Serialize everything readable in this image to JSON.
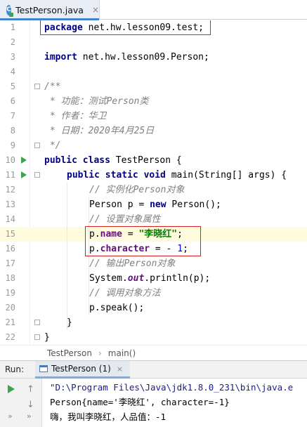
{
  "tab": {
    "icon_letter": "C",
    "filename": "TestPerson.java",
    "close": "×"
  },
  "editor": {
    "lines": [
      {
        "n": "1"
      },
      {
        "n": "2"
      },
      {
        "n": "3"
      },
      {
        "n": "4"
      },
      {
        "n": "5"
      },
      {
        "n": "6"
      },
      {
        "n": "7"
      },
      {
        "n": "8"
      },
      {
        "n": "9"
      },
      {
        "n": "10"
      },
      {
        "n": "11"
      },
      {
        "n": "12"
      },
      {
        "n": "13"
      },
      {
        "n": "14"
      },
      {
        "n": "15"
      },
      {
        "n": "16"
      },
      {
        "n": "17"
      },
      {
        "n": "18"
      },
      {
        "n": "19"
      },
      {
        "n": "20"
      },
      {
        "n": "21"
      },
      {
        "n": "22"
      }
    ],
    "code": {
      "l1_kw": "package",
      "l1_rest": " net.hw.lesson09.test;",
      "l3_kw": "import",
      "l3_rest": " net.hw.lesson09.Person;",
      "l5": "/**",
      "l6": " * 功能：测试Person类",
      "l7": " * 作者：华卫",
      "l8": " * 日期：2020年4月25日",
      "l9": " */",
      "l10_kw": "public class",
      "l10_rest": " TestPerson {",
      "l11_kw": "public static void",
      "l11_rest": " main(String[] args) {",
      "l12": "// 实例化Person对象",
      "l13_a": "Person p = ",
      "l13_kw": "new",
      "l13_b": " Person();",
      "l14": "// 设置对象属性",
      "l15_a": "p.",
      "l15_fld": "name",
      "l15_b": " = ",
      "l15_str": "\"李晓红\"",
      "l15_c": ";",
      "l16_a": "p.",
      "l16_fld": "character",
      "l16_b": " = - ",
      "l16_num": "1",
      "l16_c": ";",
      "l17": "// 输出Person对象",
      "l18_a": "System.",
      "l18_stat": "out",
      "l18_b": ".println(p);",
      "l19": "// 调用对象方法",
      "l20": "p.speak();",
      "l21": "}",
      "l22": "}"
    }
  },
  "breadcrumb": {
    "class_name": "TestPerson",
    "separator": "›",
    "method_name": "main()"
  },
  "run_panel": {
    "title": "Run:",
    "tab_label": "TestPerson (1)",
    "tab_close": "×",
    "output": [
      "\"D:\\Program Files\\Java\\jdk1.8.0_231\\bin\\java.e",
      "Person{name='李晓红', character=-1}",
      "嗨，我叫李晓红，人品值：-1"
    ]
  }
}
